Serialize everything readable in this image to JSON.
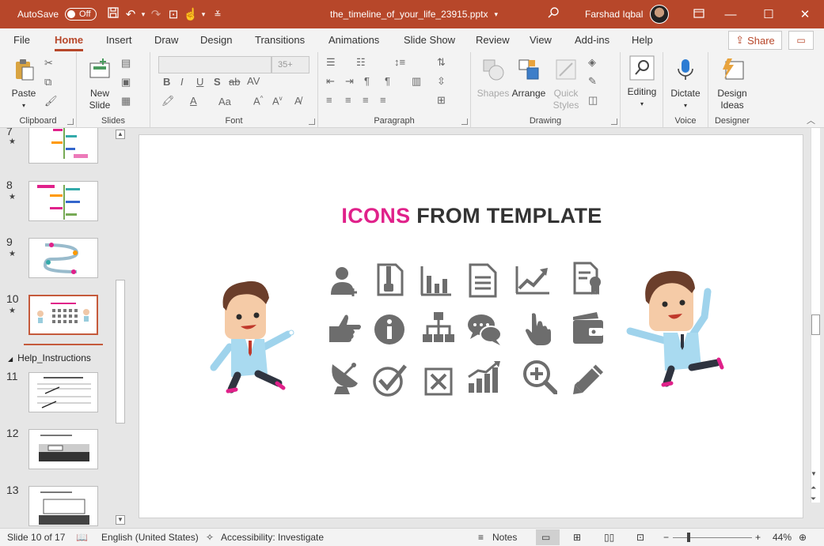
{
  "titlebar": {
    "autosave_label": "AutoSave",
    "autosave_state": "Off",
    "filename": "the_timeline_of_your_life_23915.pptx",
    "user": "Farshad Iqbal"
  },
  "tabs": [
    {
      "label": "File"
    },
    {
      "label": "Home"
    },
    {
      "label": "Insert"
    },
    {
      "label": "Draw"
    },
    {
      "label": "Design"
    },
    {
      "label": "Transitions"
    },
    {
      "label": "Animations"
    },
    {
      "label": "Slide Show"
    },
    {
      "label": "Review"
    },
    {
      "label": "View"
    },
    {
      "label": "Add-ins"
    },
    {
      "label": "Help"
    }
  ],
  "active_tab": "Home",
  "share_label": "Share",
  "ribbon": {
    "clipboard": {
      "label": "Clipboard",
      "paste": "Paste"
    },
    "slides": {
      "label": "Slides",
      "new_slide_1": "New",
      "new_slide_2": "Slide"
    },
    "font": {
      "label": "Font",
      "size_placeholder": "35+"
    },
    "paragraph": {
      "label": "Paragraph"
    },
    "drawing": {
      "label": "Drawing",
      "shapes": "Shapes",
      "arrange": "Arrange",
      "quick_styles_1": "Quick",
      "quick_styles_2": "Styles"
    },
    "editing": {
      "label": "Editing"
    },
    "voice": {
      "label": "Voice",
      "dictate": "Dictate"
    },
    "designer": {
      "label": "Designer",
      "design_ideas_1": "Design",
      "design_ideas_2": "Ideas"
    }
  },
  "slides_pane": {
    "items": [
      {
        "number": "7"
      },
      {
        "number": "8"
      },
      {
        "number": "9"
      },
      {
        "number": "10"
      },
      {
        "number": "11"
      },
      {
        "number": "12"
      },
      {
        "number": "13"
      }
    ],
    "section_title": "Help_Instructions",
    "selected": "10"
  },
  "slide": {
    "title_highlight": "ICONS",
    "title_rest": "FROM TEMPLATE",
    "icons": [
      "add-user-icon",
      "zip-file-icon",
      "bar-chart-icon",
      "document-icon",
      "trend-line-icon",
      "certificate-icon",
      "thumbs-pointing-icon",
      "info-icon",
      "org-chart-icon",
      "chat-icon",
      "pointer-hand-icon",
      "wallet-icon",
      "satellite-dish-icon",
      "checkmark-icon",
      "close-box-icon",
      "growth-chart-icon",
      "zoom-in-icon",
      "pencil-icon"
    ]
  },
  "status": {
    "slide_info": "Slide 10 of 17",
    "language": "English (United States)",
    "accessibility": "Accessibility: Investigate",
    "notes": "Notes",
    "zoom": "44%"
  },
  "colors": {
    "accent": "#b7472a",
    "highlight": "#e0218a",
    "icon_gray": "#6d6d6d"
  }
}
